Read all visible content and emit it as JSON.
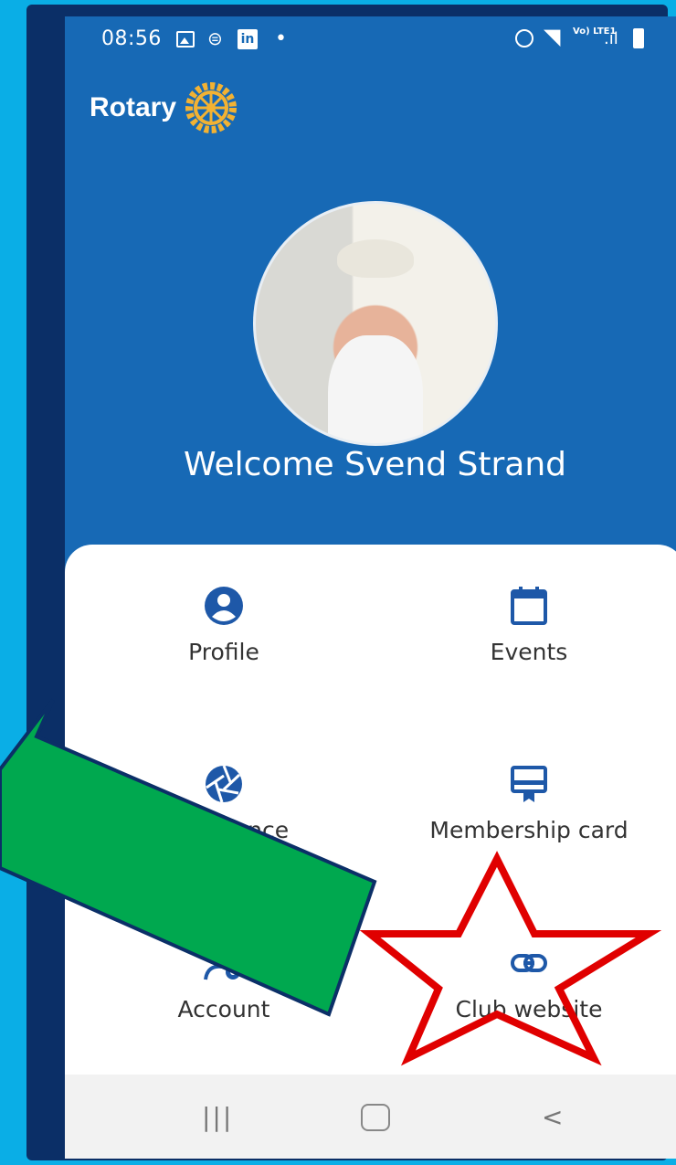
{
  "status_bar": {
    "time": "08:56",
    "network_label": "Vo) LTE1"
  },
  "header": {
    "brand": "Rotary"
  },
  "welcome_text": "Welcome Svend Strand",
  "menu": [
    {
      "label": "Profile",
      "icon": "user-circle-icon"
    },
    {
      "label": "Events",
      "icon": "calendar-icon"
    },
    {
      "label": "attendance",
      "icon": "camera-aperture-icon"
    },
    {
      "label": "Membership card",
      "icon": "card-icon"
    },
    {
      "label": "Account",
      "icon": "users-gear-icon"
    },
    {
      "label": "Club website",
      "icon": "link-icon"
    }
  ],
  "nav": {
    "recent_label": "|||",
    "back_label": "<"
  },
  "colors": {
    "brand_blue": "#1769b5",
    "frame_blue": "#0b2f67",
    "background": "#0aaee6",
    "icon_blue": "#1e58a8",
    "arrow_green": "#00a84f",
    "star_red": "#e00000"
  }
}
